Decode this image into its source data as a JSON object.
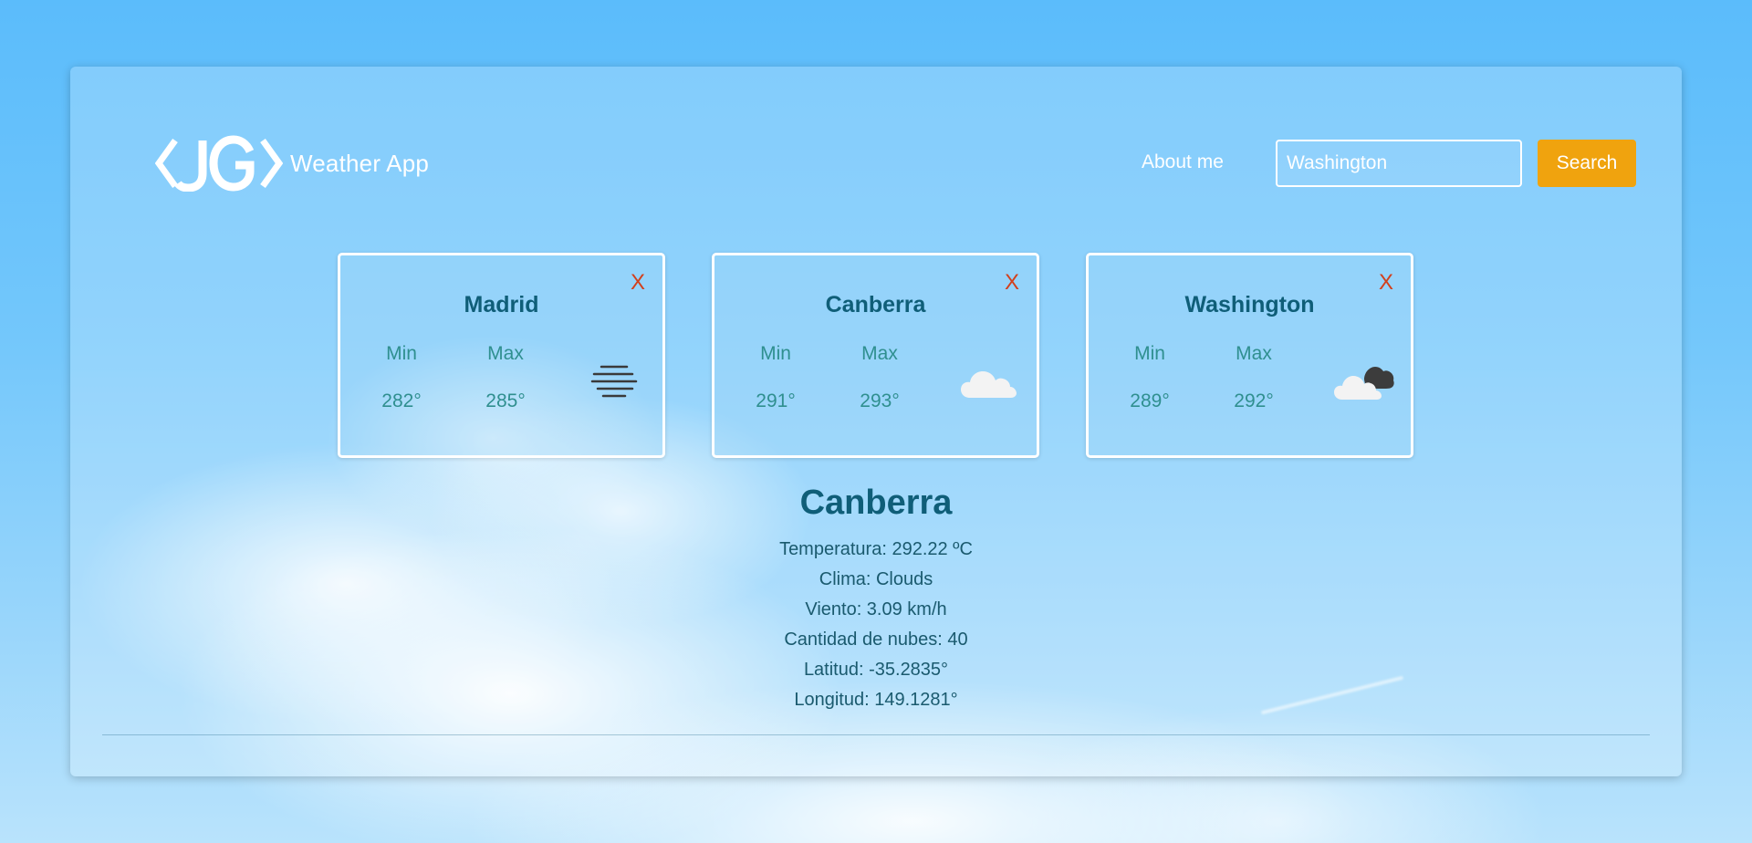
{
  "header": {
    "app_title": "Weather App",
    "about_label": "About me",
    "search_value": "Washington",
    "search_button_label": "Search"
  },
  "colors": {
    "accent": "#f0a30e",
    "close": "#d2401c",
    "city_text": "#0f5e78",
    "temp_text": "#2f8f8f"
  },
  "cards": [
    {
      "city": "Madrid",
      "close": "X",
      "min_label": "Min",
      "max_label": "Max",
      "min": "282°",
      "max": "285°",
      "icon": "mist-icon"
    },
    {
      "city": "Canberra",
      "close": "X",
      "min_label": "Min",
      "max_label": "Max",
      "min": "291°",
      "max": "293°",
      "icon": "cloud-icon"
    },
    {
      "city": "Washington",
      "close": "X",
      "min_label": "Min",
      "max_label": "Max",
      "min": "289°",
      "max": "292°",
      "icon": "broken-clouds-icon"
    }
  ],
  "detail": {
    "city": "Canberra",
    "temperatura": "Temperatura: 292.22 ºC",
    "clima": "Clima: Clouds",
    "viento": "Viento: 3.09 km/h",
    "nubes": "Cantidad de nubes: 40",
    "latitud": "Latitud: -35.2835°",
    "longitud": "Longitud: 149.1281°"
  }
}
